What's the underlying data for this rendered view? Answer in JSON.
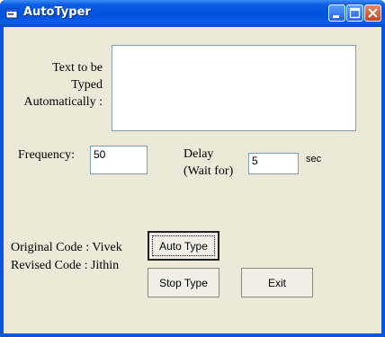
{
  "window": {
    "title": "AutoTyper",
    "minimize_icon": "minimize-icon",
    "maximize_icon": "maximize-icon",
    "close_icon": "close-icon",
    "app_icon": "app-icon"
  },
  "form": {
    "text_label_line1": "Text to be",
    "text_label_line2": "Typed",
    "text_label_line3": "Automatically :",
    "text_value": "",
    "frequency_label": "Frequency:",
    "frequency_value": "50",
    "delay_label_line1": "Delay",
    "delay_label_line2": "(Wait for)",
    "delay_value": "5",
    "delay_unit": "sec",
    "credit_original": "Original Code : Vivek",
    "credit_revised": "Revised Code : Jithin"
  },
  "buttons": {
    "auto_type": "Auto Type",
    "stop_type": "Stop Type",
    "exit": "Exit"
  },
  "colors": {
    "titlebar": "#0054e3",
    "client_bg": "#ece9d8",
    "close_button": "#d9512c"
  }
}
